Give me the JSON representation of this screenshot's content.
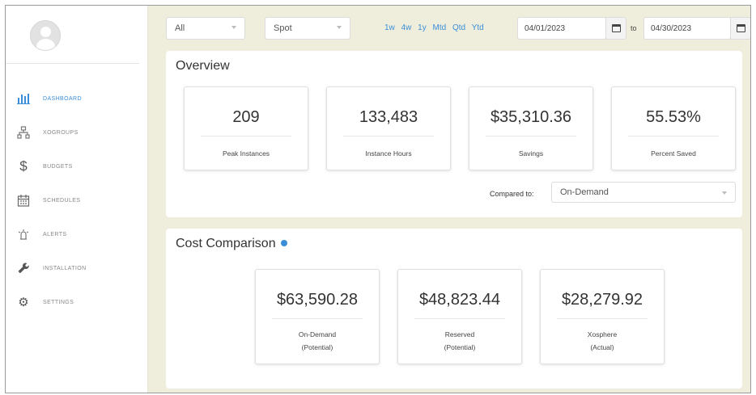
{
  "sidebar": {
    "items": [
      {
        "label": "Dashboard",
        "icon": "bar-chart-icon",
        "active": true
      },
      {
        "label": "XoGroups",
        "icon": "sitemap-icon",
        "active": false
      },
      {
        "label": "Budgets",
        "icon": "dollar-icon",
        "active": false
      },
      {
        "label": "Schedules",
        "icon": "calendar-icon",
        "active": false
      },
      {
        "label": "Alerts",
        "icon": "alert-icon",
        "active": false
      },
      {
        "label": "Installation",
        "icon": "wrench-icon",
        "active": false
      },
      {
        "label": "Settings",
        "icon": "gear-icon",
        "active": false
      }
    ],
    "icon_glyphs": {
      "dollar": "$",
      "gear": "⚙"
    }
  },
  "filters": {
    "scope": "All",
    "type": "Spot",
    "quick_ranges": [
      "1w",
      "4w",
      "1y",
      "Mtd",
      "Qtd",
      "Ytd"
    ],
    "start_date": "04/01/2023",
    "to_label": "to",
    "end_date": "04/30/2023"
  },
  "overview": {
    "title": "Overview",
    "cards": [
      {
        "value": "209",
        "caption": "Peak Instances"
      },
      {
        "value": "133,483",
        "caption": "Instance Hours"
      },
      {
        "value": "$35,310.36",
        "caption": "Savings"
      },
      {
        "value": "55.53%",
        "caption": "Percent Saved"
      }
    ],
    "compared_label": "Compared to:",
    "compared_value": "On-Demand"
  },
  "cost_comparison": {
    "title": "Cost Comparison",
    "cards": [
      {
        "value": "$63,590.28",
        "caption_1": "On-Demand",
        "caption_2": "(Potential)"
      },
      {
        "value": "$48,823.44",
        "caption_1": "Reserved",
        "caption_2": "(Potential)"
      },
      {
        "value": "$28,279.92",
        "caption_1": "Xosphere",
        "caption_2": "(Actual)"
      }
    ]
  },
  "colors": {
    "accent": "#3a8ed8",
    "background": "#efeedd"
  }
}
